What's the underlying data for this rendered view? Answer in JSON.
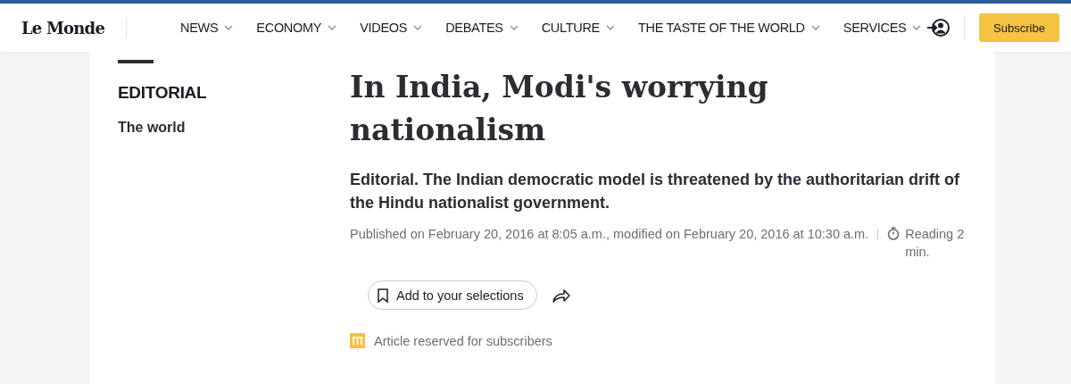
{
  "header": {
    "logo": "Le Monde",
    "nav": [
      {
        "label": "NEWS"
      },
      {
        "label": "ECONOMY"
      },
      {
        "label": "VIDEOS"
      },
      {
        "label": "DEBATES"
      },
      {
        "label": "CULTURE"
      },
      {
        "label": "THE TASTE OF THE WORLD"
      },
      {
        "label": "SERVICES"
      }
    ],
    "subscribe": "Subscribe"
  },
  "sidebar": {
    "rubric": "EDITORIAL",
    "section": "The world"
  },
  "article": {
    "title": "In India, Modi's worrying nationalism",
    "subtitle": "Editorial. The Indian democratic model is threatened by the authoritarian drift of the Hindu nationalist government.",
    "published": "Published on February 20, 2016 at 8:05 a.m., modified on February 20, 2016 at 10:30 a.m.",
    "reading_time": "Reading 2 min.",
    "save_button": "Add to your selections",
    "subscriber_note": "Article reserved for subscribers"
  }
}
